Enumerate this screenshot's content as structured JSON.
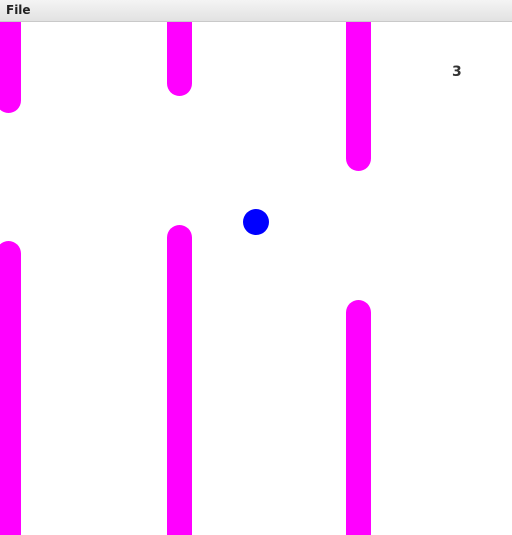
{
  "menu": {
    "file_label": "File"
  },
  "game": {
    "score": "3",
    "colors": {
      "pipe": "#ff00ff",
      "ball": "#0000ff",
      "background": "#ffffff"
    }
  }
}
